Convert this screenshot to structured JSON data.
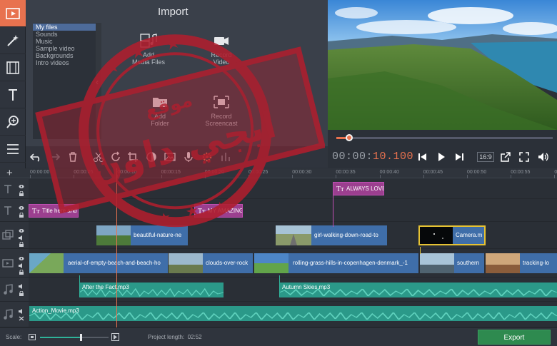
{
  "import_panel": {
    "title": "Import",
    "categories": [
      {
        "label": "My files",
        "selected": true
      },
      {
        "label": "Sounds",
        "selected": false
      },
      {
        "label": "Music",
        "selected": false
      },
      {
        "label": "Sample video",
        "selected": false
      },
      {
        "label": "Backgrounds",
        "selected": false
      },
      {
        "label": "Intro videos",
        "selected": false
      }
    ],
    "collapse_chevron": "‹",
    "buttons": [
      {
        "line1": "Add",
        "line2": "Media Files"
      },
      {
        "line1": "Record",
        "line2": "Video"
      },
      {
        "line1": "Add",
        "line2": "Folder"
      },
      {
        "line1": "Record",
        "line2": "Screencast"
      }
    ]
  },
  "left_rail": {
    "tools": [
      "import-icon",
      "magic-wand-icon",
      "filmstrip-icon",
      "text-icon",
      "zoom-add-icon",
      "more-menu-icon"
    ]
  },
  "toolbar": {
    "tools": [
      "undo-icon",
      "redo-icon",
      "delete-icon",
      "cut-icon",
      "rotate-icon",
      "crop-icon",
      "color-adjust-icon",
      "image-icon",
      "microphone-icon",
      "settings-icon",
      "equalizer-icon"
    ]
  },
  "player": {
    "timecode_main": "00:00:",
    "timecode_frac": "10.100",
    "aspect_ratio": "16:9",
    "seek_progress": 0.02
  },
  "timeline": {
    "ticks": [
      "00:00:00",
      "00:00:05",
      "00:00:10",
      "00:00:15",
      "00:00:20",
      "00:00:25",
      "00:00:30",
      "00:00:35",
      "00:00:40",
      "00:00:45",
      "00:00:50",
      "00:00:55",
      "00:01:00"
    ],
    "title_clips_top": [
      "ALWAYS LOVE"
    ],
    "title_clips": [
      "Title here and",
      "MY AMAZING"
    ],
    "overlay_clips": [
      "beautiful-nature-ne",
      "girl-walking-down-road-to",
      "Camera.m"
    ],
    "video_clips": [
      "aerial-of-empty-beach-and-beach-ho",
      "clouds-over-rock",
      "rolling-grass-hills-in-copenhagen-denmark_-1",
      "southern",
      "tracking-lo"
    ],
    "audio_clips": [
      "After the Fact.mp3",
      "Autumn Skies.mp3"
    ],
    "music_clips": [
      "Action_Movie.mp3"
    ]
  },
  "status_bar": {
    "scale_label": "Scale:",
    "scale_value": 0.59,
    "project_length_label": "Project length:",
    "project_length_value": "02:52",
    "export_label": "Export"
  },
  "watermark": {
    "text_line1": "موقع",
    "text_line2": "ايجي داون"
  },
  "colors": {
    "accent": "#e8724f",
    "title_clip": "#9b3f8f",
    "video_clip": "#3f6ea9",
    "audio_clip": "#2b9989",
    "export": "#2e8a4f",
    "stamp": "#b01e2e"
  }
}
